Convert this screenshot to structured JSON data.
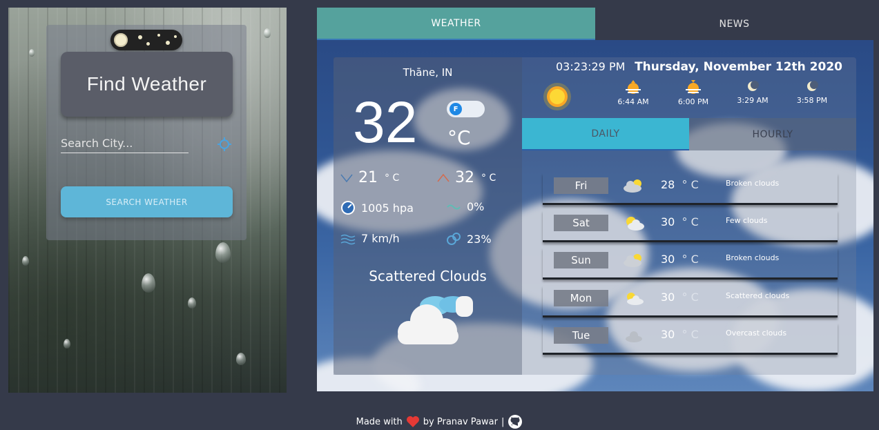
{
  "left": {
    "title": "Find Weather",
    "search_placeholder": "Search City...",
    "search_button": "SEARCH WEATHER"
  },
  "tabs": [
    {
      "label": "WEATHER",
      "active": true
    },
    {
      "label": "NEWS",
      "active": false
    }
  ],
  "current": {
    "city": "Thāne, IN",
    "temp": "32",
    "unit": "°C",
    "unit_toggle": "F",
    "min_temp": "21",
    "max_temp": "32",
    "deg_unit": "° C",
    "pressure": "1005 hpa",
    "humidity": "0%",
    "wind": "7 km/h",
    "cloudiness": "23%",
    "description": "Scattered Clouds"
  },
  "header": {
    "time": "03:23:29 PM",
    "date": "Thursday, November 12th 2020",
    "astro": [
      {
        "icon": "sunrise-icon",
        "time": "6:44 AM"
      },
      {
        "icon": "sunset-icon",
        "time": "6:00 PM"
      },
      {
        "icon": "moonrise-icon",
        "time": "3:29 AM"
      },
      {
        "icon": "moonset-icon",
        "time": "3:58 PM"
      }
    ]
  },
  "subtabs": [
    {
      "label": "DAILY",
      "active": true
    },
    {
      "label": "HOURLY",
      "active": false
    }
  ],
  "forecast": [
    {
      "day": "Fri",
      "temp": "28",
      "unit": "° C",
      "desc": "Broken clouds",
      "icon": "broken-clouds-icon"
    },
    {
      "day": "Sat",
      "temp": "30",
      "unit": "° C",
      "desc": "Few clouds",
      "icon": "few-clouds-icon"
    },
    {
      "day": "Sun",
      "temp": "30",
      "unit": "° C",
      "desc": "Broken clouds",
      "icon": "broken-clouds-icon"
    },
    {
      "day": "Mon",
      "temp": "30",
      "unit": "° C",
      "desc": "Scattered clouds",
      "icon": "scattered-clouds-icon"
    },
    {
      "day": "Tue",
      "temp": "30",
      "unit": "° C",
      "desc": "Overcast clouds",
      "icon": "overcast-clouds-icon"
    }
  ],
  "footer": {
    "made_with": "Made with",
    "by": "by Pranav Pawar",
    "separator": "|"
  },
  "colors": {
    "accent_teal": "#55a29d",
    "accent_cyan": "#3bb6d2",
    "search_button": "#5eb6d8",
    "background": "#353a4a",
    "heart": "#e53935"
  }
}
